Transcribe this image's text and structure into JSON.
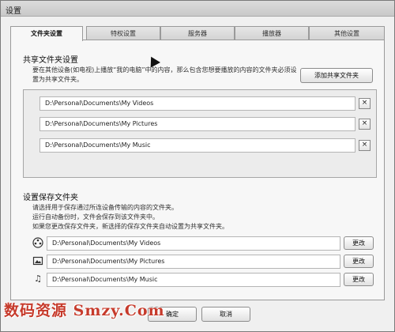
{
  "window": {
    "title": "设置"
  },
  "tabs": [
    {
      "label": "文件夹设置",
      "active": true
    },
    {
      "label": "特权设置",
      "active": false
    },
    {
      "label": "服务器",
      "active": false
    },
    {
      "label": "播放器",
      "active": false
    },
    {
      "label": "其他设置",
      "active": false
    }
  ],
  "shared": {
    "title": "共享文件夹设置",
    "description": "要在其他设备(如电视)上播放“我的电脑”中的内容，那么包含您想要播放的内容的文件夹必须设置为共享文件夹。",
    "add_button": "添加共享文件夹",
    "folders": [
      {
        "path": "D:\\Personal\\Documents\\My Videos",
        "remove": "×"
      },
      {
        "path": "D:\\Personal\\Documents\\My Pictures",
        "remove": "×"
      },
      {
        "path": "D:\\Personal\\Documents\\My Music",
        "remove": "×"
      }
    ]
  },
  "save": {
    "title": "设置保存文件夹",
    "description_lines": [
      "请选择用于保存通过所连设备传输的内容的文件夹。",
      "运行自动备份时，文件会保存到该文件夹中。",
      "如果您更改保存文件夹，新选择的保存文件夹自动设置为共享文件夹。"
    ],
    "rows": [
      {
        "icon": "film-reel-icon",
        "path": "D:\\Personal\\Documents\\My Videos",
        "button": "更改"
      },
      {
        "icon": "picture-icon",
        "path": "D:\\Personal\\Documents\\My Pictures",
        "button": "更改"
      },
      {
        "icon": "music-note-icon",
        "path": "D:\\Personal\\Documents\\My Music",
        "button": "更改"
      }
    ]
  },
  "footer": {
    "ok": "确定",
    "cancel": "取消"
  },
  "watermark": "数码资源 Smzy.Com",
  "colors": {
    "watermark": "#c63a2b"
  }
}
